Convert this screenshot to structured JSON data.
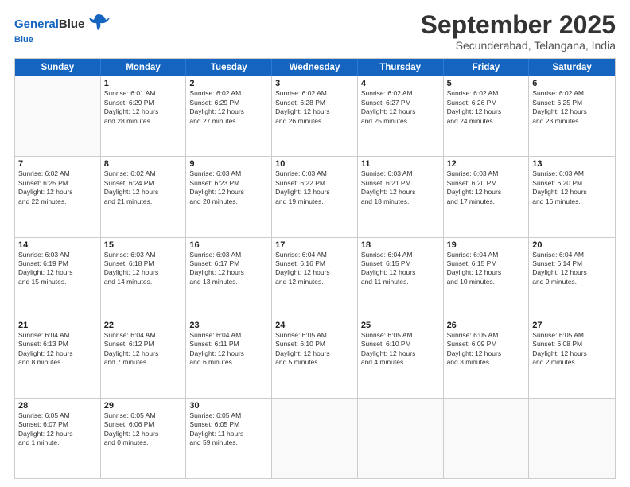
{
  "header": {
    "logo_line1": "General",
    "logo_line2": "Blue",
    "month": "September 2025",
    "location": "Secunderabad, Telangana, India"
  },
  "days": [
    "Sunday",
    "Monday",
    "Tuesday",
    "Wednesday",
    "Thursday",
    "Friday",
    "Saturday"
  ],
  "weeks": [
    [
      {
        "day": "",
        "info": ""
      },
      {
        "day": "1",
        "info": "Sunrise: 6:01 AM\nSunset: 6:29 PM\nDaylight: 12 hours\nand 28 minutes."
      },
      {
        "day": "2",
        "info": "Sunrise: 6:02 AM\nSunset: 6:29 PM\nDaylight: 12 hours\nand 27 minutes."
      },
      {
        "day": "3",
        "info": "Sunrise: 6:02 AM\nSunset: 6:28 PM\nDaylight: 12 hours\nand 26 minutes."
      },
      {
        "day": "4",
        "info": "Sunrise: 6:02 AM\nSunset: 6:27 PM\nDaylight: 12 hours\nand 25 minutes."
      },
      {
        "day": "5",
        "info": "Sunrise: 6:02 AM\nSunset: 6:26 PM\nDaylight: 12 hours\nand 24 minutes."
      },
      {
        "day": "6",
        "info": "Sunrise: 6:02 AM\nSunset: 6:25 PM\nDaylight: 12 hours\nand 23 minutes."
      }
    ],
    [
      {
        "day": "7",
        "info": "Sunrise: 6:02 AM\nSunset: 6:25 PM\nDaylight: 12 hours\nand 22 minutes."
      },
      {
        "day": "8",
        "info": "Sunrise: 6:02 AM\nSunset: 6:24 PM\nDaylight: 12 hours\nand 21 minutes."
      },
      {
        "day": "9",
        "info": "Sunrise: 6:03 AM\nSunset: 6:23 PM\nDaylight: 12 hours\nand 20 minutes."
      },
      {
        "day": "10",
        "info": "Sunrise: 6:03 AM\nSunset: 6:22 PM\nDaylight: 12 hours\nand 19 minutes."
      },
      {
        "day": "11",
        "info": "Sunrise: 6:03 AM\nSunset: 6:21 PM\nDaylight: 12 hours\nand 18 minutes."
      },
      {
        "day": "12",
        "info": "Sunrise: 6:03 AM\nSunset: 6:20 PM\nDaylight: 12 hours\nand 17 minutes."
      },
      {
        "day": "13",
        "info": "Sunrise: 6:03 AM\nSunset: 6:20 PM\nDaylight: 12 hours\nand 16 minutes."
      }
    ],
    [
      {
        "day": "14",
        "info": "Sunrise: 6:03 AM\nSunset: 6:19 PM\nDaylight: 12 hours\nand 15 minutes."
      },
      {
        "day": "15",
        "info": "Sunrise: 6:03 AM\nSunset: 6:18 PM\nDaylight: 12 hours\nand 14 minutes."
      },
      {
        "day": "16",
        "info": "Sunrise: 6:03 AM\nSunset: 6:17 PM\nDaylight: 12 hours\nand 13 minutes."
      },
      {
        "day": "17",
        "info": "Sunrise: 6:04 AM\nSunset: 6:16 PM\nDaylight: 12 hours\nand 12 minutes."
      },
      {
        "day": "18",
        "info": "Sunrise: 6:04 AM\nSunset: 6:15 PM\nDaylight: 12 hours\nand 11 minutes."
      },
      {
        "day": "19",
        "info": "Sunrise: 6:04 AM\nSunset: 6:15 PM\nDaylight: 12 hours\nand 10 minutes."
      },
      {
        "day": "20",
        "info": "Sunrise: 6:04 AM\nSunset: 6:14 PM\nDaylight: 12 hours\nand 9 minutes."
      }
    ],
    [
      {
        "day": "21",
        "info": "Sunrise: 6:04 AM\nSunset: 6:13 PM\nDaylight: 12 hours\nand 8 minutes."
      },
      {
        "day": "22",
        "info": "Sunrise: 6:04 AM\nSunset: 6:12 PM\nDaylight: 12 hours\nand 7 minutes."
      },
      {
        "day": "23",
        "info": "Sunrise: 6:04 AM\nSunset: 6:11 PM\nDaylight: 12 hours\nand 6 minutes."
      },
      {
        "day": "24",
        "info": "Sunrise: 6:05 AM\nSunset: 6:10 PM\nDaylight: 12 hours\nand 5 minutes."
      },
      {
        "day": "25",
        "info": "Sunrise: 6:05 AM\nSunset: 6:10 PM\nDaylight: 12 hours\nand 4 minutes."
      },
      {
        "day": "26",
        "info": "Sunrise: 6:05 AM\nSunset: 6:09 PM\nDaylight: 12 hours\nand 3 minutes."
      },
      {
        "day": "27",
        "info": "Sunrise: 6:05 AM\nSunset: 6:08 PM\nDaylight: 12 hours\nand 2 minutes."
      }
    ],
    [
      {
        "day": "28",
        "info": "Sunrise: 6:05 AM\nSunset: 6:07 PM\nDaylight: 12 hours\nand 1 minute."
      },
      {
        "day": "29",
        "info": "Sunrise: 6:05 AM\nSunset: 6:06 PM\nDaylight: 12 hours\nand 0 minutes."
      },
      {
        "day": "30",
        "info": "Sunrise: 6:05 AM\nSunset: 6:05 PM\nDaylight: 11 hours\nand 59 minutes."
      },
      {
        "day": "",
        "info": ""
      },
      {
        "day": "",
        "info": ""
      },
      {
        "day": "",
        "info": ""
      },
      {
        "day": "",
        "info": ""
      }
    ]
  ]
}
